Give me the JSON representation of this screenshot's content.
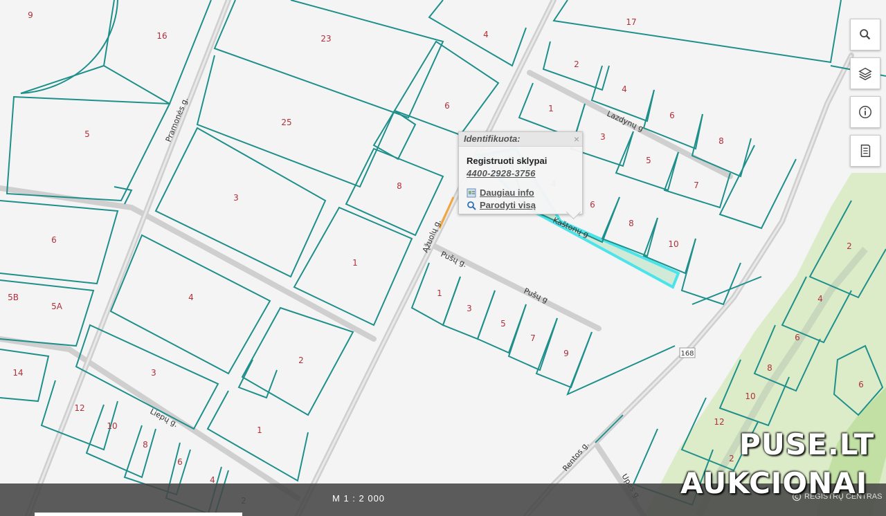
{
  "map": {
    "streets": [
      {
        "id": "pramones",
        "name": "Pramonės g."
      },
      {
        "id": "azuolu",
        "name": "Ąžuolų g."
      },
      {
        "id": "pusu1",
        "name": "Pušų g."
      },
      {
        "id": "pusu2",
        "name": "Pušų g"
      },
      {
        "id": "kastonu",
        "name": "Kaštonų g"
      },
      {
        "id": "lazdynu",
        "name": "Lazdynų g"
      },
      {
        "id": "liepu",
        "name": "Liepų g."
      },
      {
        "id": "rentos",
        "name": "Rentos g."
      },
      {
        "id": "upes",
        "name": "Upės g."
      }
    ],
    "road_badge": "168",
    "parcels": [
      {
        "id": "p9",
        "label": "9"
      },
      {
        "id": "p16",
        "label": "16"
      },
      {
        "id": "p23",
        "label": "23"
      },
      {
        "id": "p4top",
        "label": "4"
      },
      {
        "id": "p17",
        "label": "17"
      },
      {
        "id": "p5left",
        "label": "5"
      },
      {
        "id": "p25",
        "label": "25"
      },
      {
        "id": "p6mid",
        "label": "6"
      },
      {
        "id": "pl2",
        "label": "2"
      },
      {
        "id": "pl4",
        "label": "4"
      },
      {
        "id": "pl1",
        "label": "1"
      },
      {
        "id": "pl6",
        "label": "6"
      },
      {
        "id": "pl3",
        "label": "3"
      },
      {
        "id": "pl8",
        "label": "8"
      },
      {
        "id": "pl5",
        "label": "5"
      },
      {
        "id": "pl7",
        "label": "7"
      },
      {
        "id": "p3left",
        "label": "3"
      },
      {
        "id": "p8mid",
        "label": "8"
      },
      {
        "id": "pk4",
        "label": "4"
      },
      {
        "id": "pk6",
        "label": "6"
      },
      {
        "id": "pk8",
        "label": "8"
      },
      {
        "id": "pk10",
        "label": "10"
      },
      {
        "id": "p6left",
        "label": "6"
      },
      {
        "id": "p1mid",
        "label": "1"
      },
      {
        "id": "p5b",
        "label": "5B"
      },
      {
        "id": "p5a",
        "label": "5A"
      },
      {
        "id": "p4left",
        "label": "4"
      },
      {
        "id": "pp1",
        "label": "1"
      },
      {
        "id": "pp3",
        "label": "3"
      },
      {
        "id": "pp5",
        "label": "5"
      },
      {
        "id": "pp7",
        "label": "7"
      },
      {
        "id": "pp9",
        "label": "9"
      },
      {
        "id": "p14",
        "label": "14"
      },
      {
        "id": "p3low",
        "label": "3"
      },
      {
        "id": "p2low",
        "label": "2"
      },
      {
        "id": "pr2",
        "label": "2"
      },
      {
        "id": "pr4",
        "label": "4"
      },
      {
        "id": "pr6",
        "label": "6"
      },
      {
        "id": "pr8",
        "label": "8"
      },
      {
        "id": "pr10",
        "label": "10"
      },
      {
        "id": "pr12",
        "label": "12"
      },
      {
        "id": "pr2low",
        "label": "2"
      },
      {
        "id": "pr6far",
        "label": "6"
      },
      {
        "id": "pli12",
        "label": "12"
      },
      {
        "id": "pli10",
        "label": "10"
      },
      {
        "id": "pli8",
        "label": "8"
      },
      {
        "id": "pli6",
        "label": "6"
      },
      {
        "id": "pli4",
        "label": "4"
      },
      {
        "id": "pli2",
        "label": "2"
      },
      {
        "id": "p1low",
        "label": "1"
      }
    ]
  },
  "toolbar": {
    "search_icon": "search-icon",
    "layers_icon": "layers-icon",
    "info_icon": "info-icon",
    "legend_icon": "document-icon"
  },
  "popup": {
    "title": "Identifikuota:",
    "close": "×",
    "section": "Registruoti sklypai",
    "parcel_id": "4400-2928-3756",
    "more_info": "Daugiau info",
    "show_all": "Parodyti visą"
  },
  "bottom_bar": {
    "scale": "M 1 : 2 000",
    "credit": "REGISTRŲ CENTRAS"
  },
  "watermark": {
    "line1": "PUSE.LT",
    "line2": "AUKCIONAI"
  },
  "colors": {
    "parcel_line": "#1e8f8a",
    "road": "#c9c9c9",
    "label": "#b0303a",
    "highlight": "#4de3ea",
    "river_green": "#cfe6b6"
  }
}
